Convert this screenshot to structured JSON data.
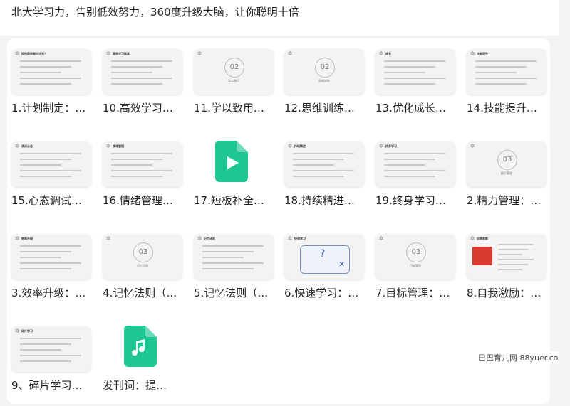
{
  "page": {
    "title": "北大学习力，告别低效努力，360度升级大脑，让你聪明十倍"
  },
  "watermark": "巴巴育儿网 88yuer.com",
  "colors": {
    "video_file": "#1ec792",
    "audio_file": "#1ec792",
    "accent_red": "#d83b2f"
  },
  "items": [
    {
      "caption": "1.计划制定：…",
      "thumb": {
        "kind": "slide",
        "heading": "如何高效制定计划？"
      }
    },
    {
      "caption": "10.高效学习…",
      "thumb": {
        "kind": "slide",
        "heading": "高效学习要素"
      }
    },
    {
      "caption": "11.学以致用…",
      "thumb": {
        "kind": "section",
        "number": "02",
        "subtitle": "学以致用"
      }
    },
    {
      "caption": "12.思维训练…",
      "thumb": {
        "kind": "section",
        "number": "02",
        "subtitle": "思维训练"
      }
    },
    {
      "caption": "13.优化成长…",
      "thumb": {
        "kind": "slide",
        "heading": "成长"
      }
    },
    {
      "caption": "14.技能提升…",
      "thumb": {
        "kind": "slide",
        "heading": "技能提升"
      }
    },
    {
      "caption": "15.心态调试…",
      "thumb": {
        "kind": "slide",
        "heading": "调试心态"
      }
    },
    {
      "caption": "16.情绪管理…",
      "thumb": {
        "kind": "slide",
        "heading": "情绪管理"
      }
    },
    {
      "caption": "17.短板补全…",
      "thumb": {
        "kind": "video",
        "icon": "video-file-icon"
      }
    },
    {
      "caption": "18.持续精进…",
      "thumb": {
        "kind": "slide",
        "heading": "持续精进"
      }
    },
    {
      "caption": "19.终身学习…",
      "thumb": {
        "kind": "slide",
        "heading": "终身学习"
      }
    },
    {
      "caption": "2.精力管理：…",
      "thumb": {
        "kind": "section",
        "number": "03",
        "subtitle": "精力管理"
      }
    },
    {
      "caption": "3.效率升级：…",
      "thumb": {
        "kind": "slide",
        "heading": "效率升级"
      }
    },
    {
      "caption": "4.记忆法则（…",
      "thumb": {
        "kind": "section",
        "number": "03",
        "subtitle": "记忆法则"
      }
    },
    {
      "caption": "5.记忆法则（…",
      "thumb": {
        "kind": "slide",
        "heading": "记忆法则"
      }
    },
    {
      "caption": "6.快速学习：…",
      "thumb": {
        "kind": "diagram",
        "heading": "快速学习"
      }
    },
    {
      "caption": "7.目标管理：…",
      "thumb": {
        "kind": "section",
        "number": "03",
        "subtitle": "目标管理"
      }
    },
    {
      "caption": "8.自我激励：…",
      "thumb": {
        "kind": "photo",
        "heading": "自我激励"
      }
    },
    {
      "caption": "9、碎片学习…",
      "thumb": {
        "kind": "slide",
        "heading": "碎片学习"
      }
    },
    {
      "caption": "发刊词：提…",
      "thumb": {
        "kind": "audio",
        "icon": "audio-file-icon"
      }
    }
  ]
}
